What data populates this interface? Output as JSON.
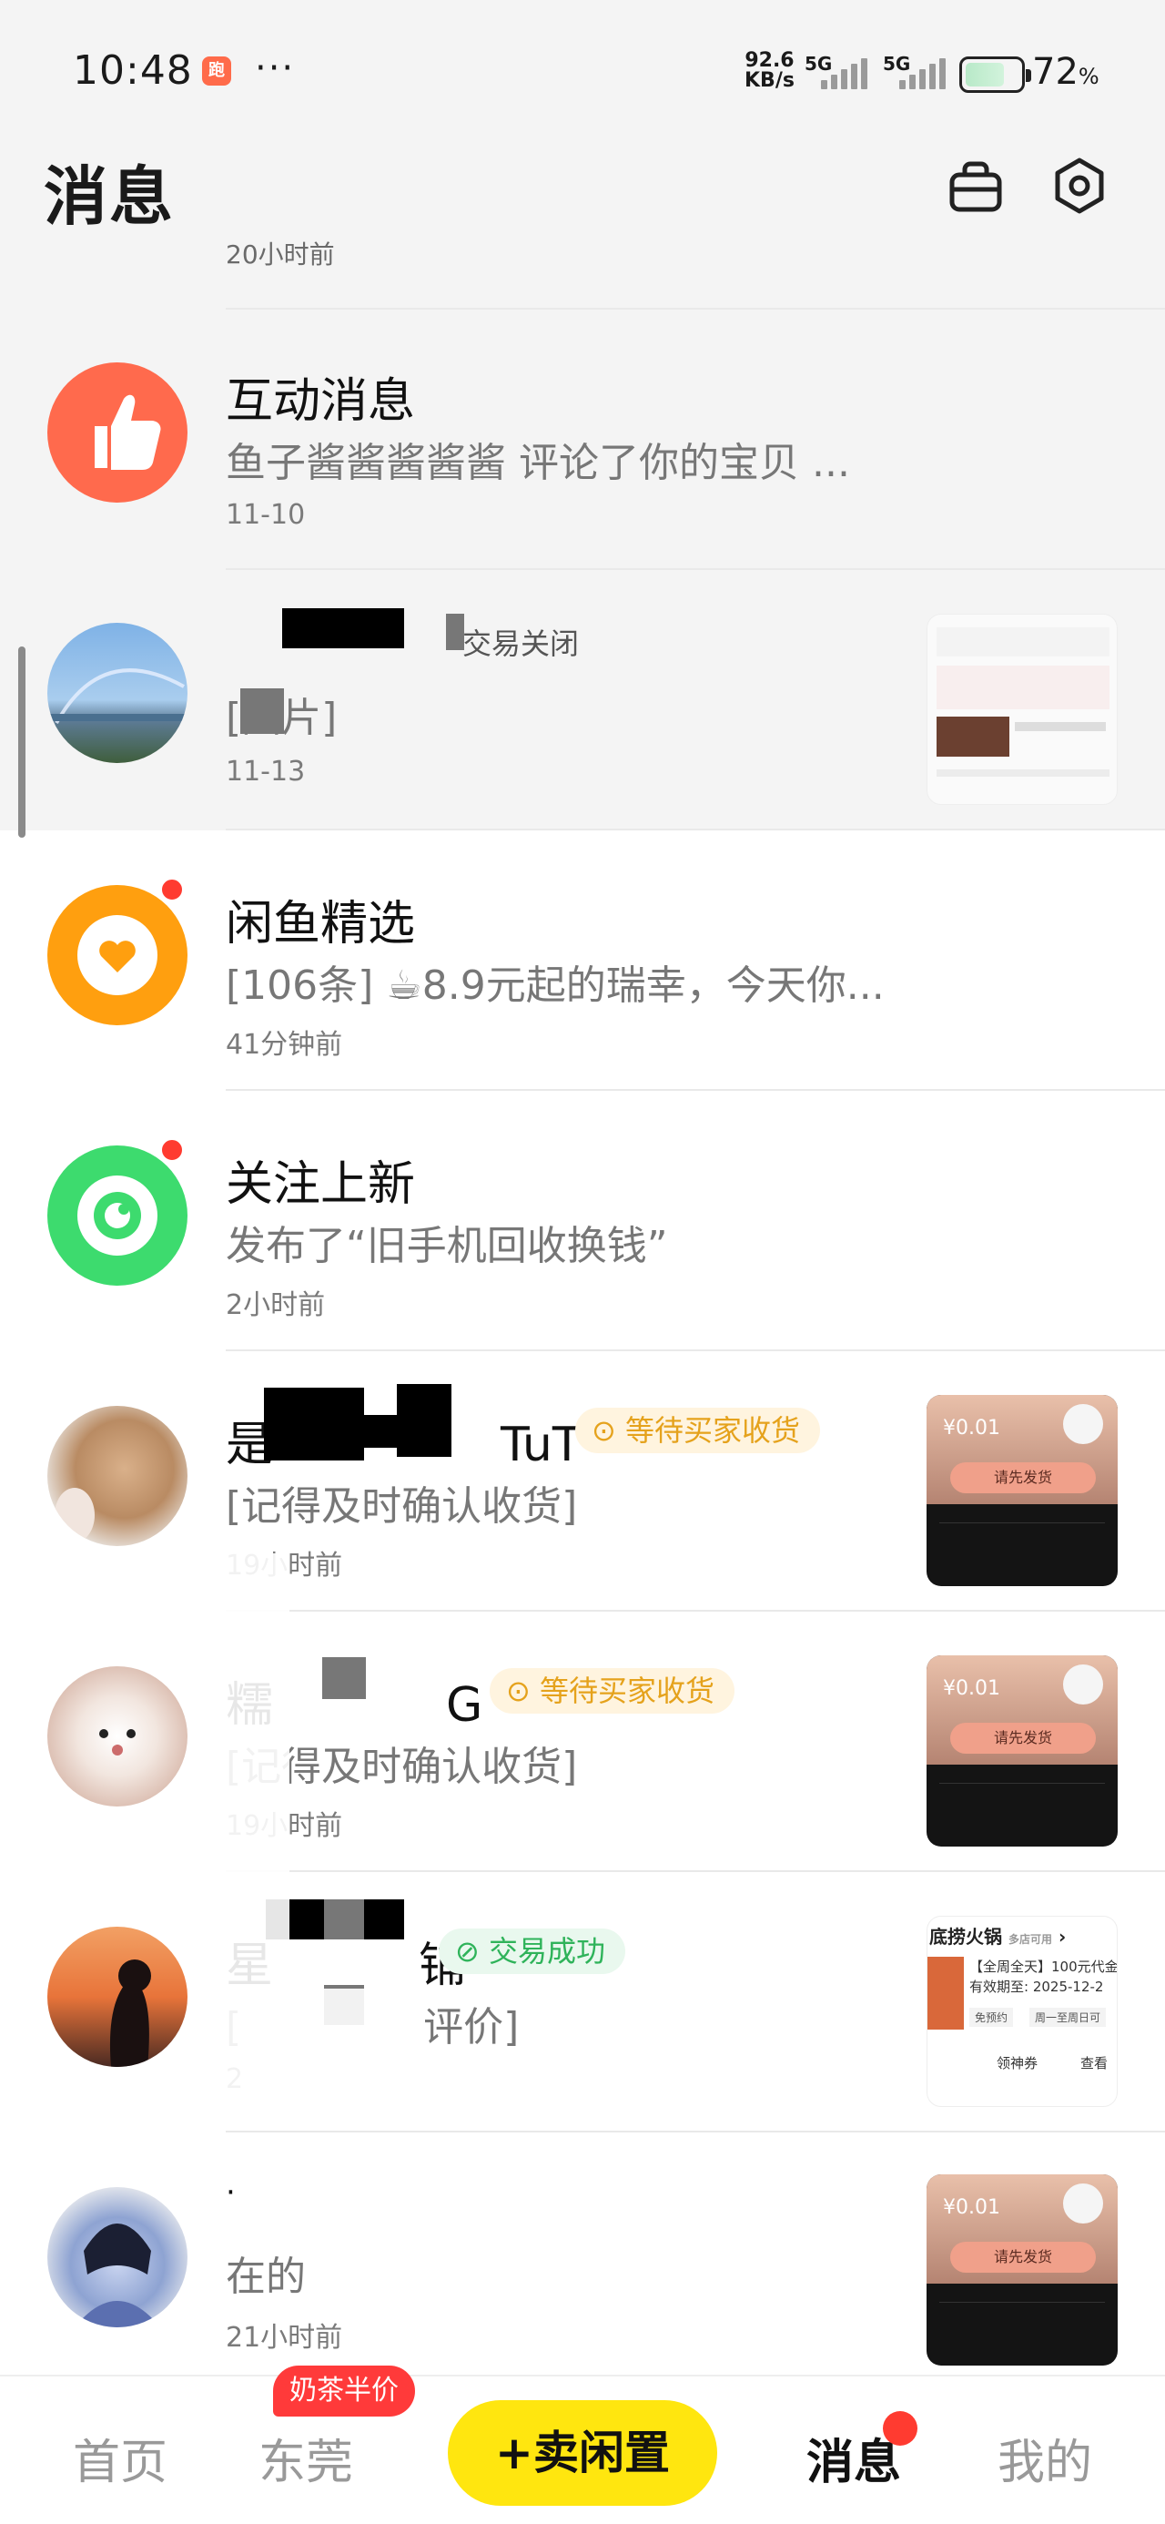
{
  "status_bar": {
    "time": "10:48",
    "more": "···",
    "net_speed_value": "92.6",
    "net_speed_unit": "KB/s",
    "sim1_label": "5G",
    "sim2_label": "5G",
    "battery_percent": "72",
    "battery_unit": "%",
    "battery_level": 0.72
  },
  "header": {
    "title": "消息",
    "icons": [
      "bag-icon",
      "gear-icon"
    ]
  },
  "cut_off_timestamp": "20小时前",
  "conversations": [
    {
      "title": "互动消息",
      "preview": "鱼子酱酱酱酱酱 评论了你的宝贝 ...",
      "time": "11-10",
      "icon": "thumbs-up-icon",
      "color": "#ff6a4d"
    },
    {
      "title": "",
      "badge": "交易关闭",
      "preview": "[图片]",
      "time": "11-13",
      "has_thumbnail": true
    },
    {
      "title": "闲鱼精选",
      "preview": "[106条] ☕8.9元起的瑞幸，今天你...",
      "time": "41分钟前",
      "icon": "heart-icon",
      "color": "#ff9f0f",
      "unread": true
    },
    {
      "title": "关注上新",
      "preview": "发布了“旧手机回收换钱”",
      "time": "2小时前",
      "icon": "eye-icon",
      "color": "#3ddb6e",
      "unread": true
    },
    {
      "title_prefix": "是",
      "title_suffix": "TuT",
      "badge": "等待买家收货",
      "preview": "[记得及时确认收货]",
      "time": "19小时前",
      "has_thumbnail": true
    },
    {
      "title_prefix": "糯",
      "title_suffix": "",
      "badge": "等待买家收货",
      "preview": "[记得及时确认收货]",
      "time": "19小时前",
      "has_thumbnail": true
    },
    {
      "title_prefix": "星",
      "title_suffix": "铺",
      "badge": "交易成功",
      "preview": "评价]",
      "time": "2",
      "has_thumbnail": true
    },
    {
      "title": "·",
      "preview": "在的",
      "time": "21小时前",
      "has_thumbnail": true
    }
  ],
  "thumbnails": {
    "voucher_brand": "底捞火锅",
    "voucher_tag": "多店可用",
    "voucher_line1": "【全周全天】100元代金",
    "voucher_line2": "有效期至: 2025-12-2",
    "voucher_btn1": "免预约",
    "voucher_btn2": "周一至周日可",
    "voucher_btn3": "领神券",
    "voucher_btn4": "查看",
    "price_label": "¥0.01",
    "order_btn": "请先发货"
  },
  "bottom_nav": {
    "home": "首页",
    "city": "东莞",
    "promo": "奶茶半价",
    "sell": "卖闲置",
    "messages": "消息",
    "me": "我的"
  }
}
